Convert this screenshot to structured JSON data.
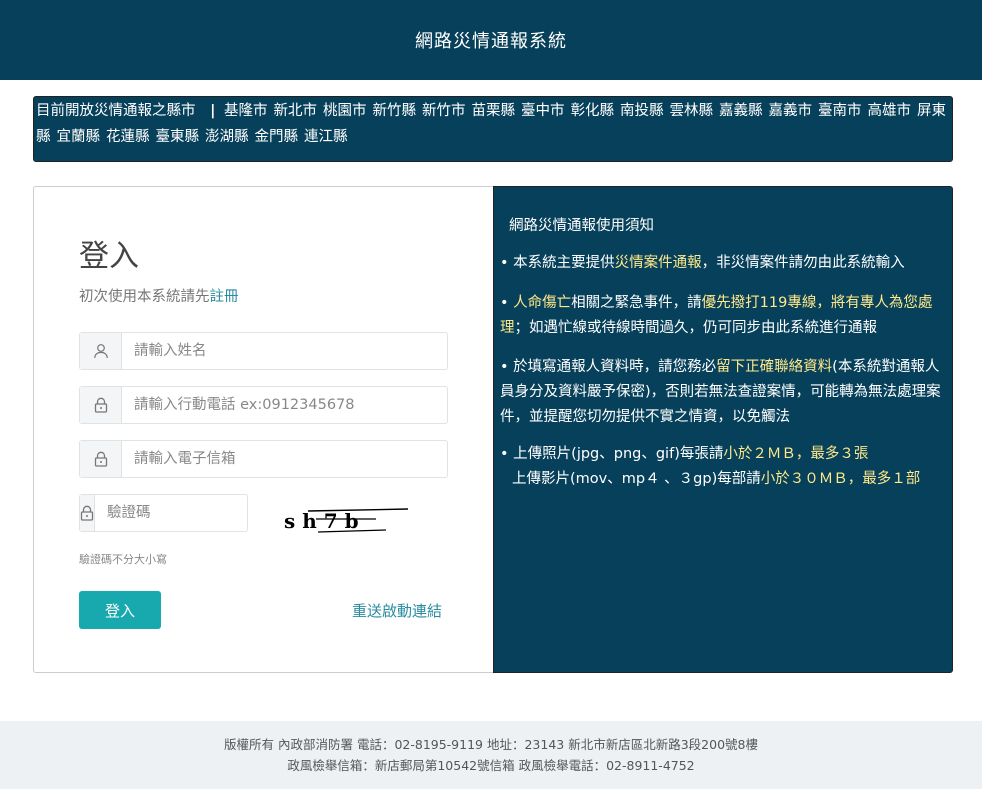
{
  "header": {
    "title": "網路災情通報系統"
  },
  "county_bar": {
    "lead": "目前開放災情通報之縣市",
    "separator": "|",
    "counties": [
      "基隆市",
      "新北市",
      "桃園市",
      "新竹縣",
      "新竹市",
      "苗栗縣",
      "臺中市",
      "彰化縣",
      "南投縣",
      "雲林縣",
      "嘉義縣",
      "嘉義市",
      "臺南市",
      "高雄市",
      "屏東縣",
      "宜蘭縣",
      "花蓮縣",
      "臺東縣",
      "澎湖縣",
      "金門縣",
      "連江縣"
    ]
  },
  "login": {
    "title": "登入",
    "register_prefix": "初次使用本系統請先",
    "register_link": "註冊",
    "name_placeholder": "請輸入姓名",
    "phone_placeholder": "請輸入行動電話 ex:0912345678",
    "email_placeholder": "請輸入電子信箱",
    "captcha_placeholder": "驗證碼",
    "captcha_text": "s h 7 b",
    "captcha_hint": "驗證碼不分大小寫",
    "login_button": "登入",
    "resend_link": "重送啟動連結"
  },
  "notice": {
    "title": "網路災情通報使用須知",
    "item1_a": "• 本系統主要提供",
    "item1_hl": "災情案件通報",
    "item1_b": "，非災情案件請勿由此系統輸入",
    "item2_a": "• ",
    "item2_hl1": "人命傷亡",
    "item2_b": "相關之緊急事件，請",
    "item2_hl2": "優先撥打119專線，將有專人為您處理",
    "item2_c": "；如遇忙線或待線時間過久，仍可同步由此系統進行通報",
    "item3_a": "• 於填寫通報人資料時，請您務必",
    "item3_hl": "留下正確聯絡資料",
    "item3_b": "(本系統對通報人員身分及資料嚴予保密)，否則若無法查證案情，可能轉為無法處理案件，並提醒您切勿提供不實之情資，以免觸法",
    "item4_a": "• 上傳照片(jpg、png、gif)每張請",
    "item4_hl1": "小於２ＭＢ，最多３張",
    "item4_b": "上傳影片(mov、mp４ 、３gp)每部請",
    "item4_hl2": "小於３０ＭＢ，最多１部"
  },
  "footer": {
    "line1": "版權所有 內政部消防署 電話：02-8195-9119 地址：23143 新北市新店區北新路3段200號8樓",
    "line2": "政風檢舉信箱：新店郵局第10542號信箱 政風檢舉電話：02-8911-4752"
  },
  "colors": {
    "header_bg": "#07405a",
    "accent": "#17a9ad",
    "highlight": "#ffe98a",
    "link": "#2a8ca0"
  },
  "icons": {
    "name_field": "user-icon",
    "other_fields": "lock-icon"
  }
}
